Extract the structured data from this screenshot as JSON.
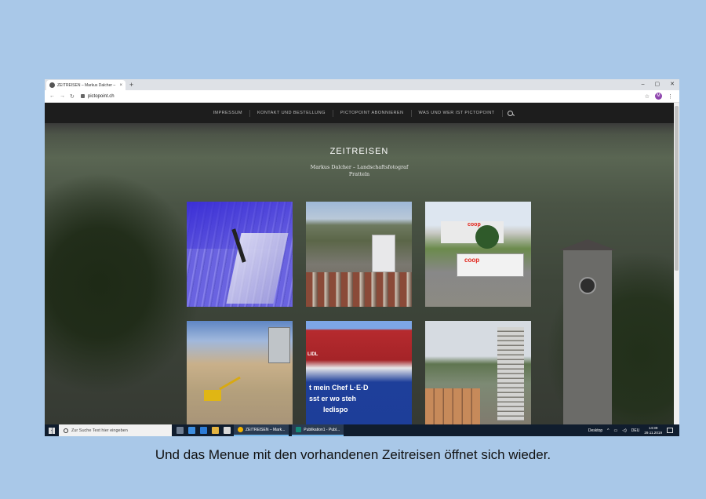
{
  "browser": {
    "tab_title": "ZEITREISEN – Markus Dalcher – L",
    "tab_close": "×",
    "new_tab": "+",
    "url": "pictopoint.ch",
    "window_controls": [
      "–",
      "▢",
      "✕"
    ],
    "profile_initial": "M"
  },
  "site": {
    "nav": [
      "IMPRESSUM",
      "KONTAKT UND BESTELLUNG",
      "PICTOPOINT ABONNIEREN",
      "WAS UND WER IST PICTOPOINT"
    ],
    "title": "ZEITREISEN",
    "desc_line1": "Markus Dalcher – Landschaftsfotograf",
    "desc_line2": "Pratteln",
    "thumb3_brand": "coop",
    "thumb3_truck_brand": "coop",
    "thumb5_brand": "LIDL",
    "thumb5_line1": "t mein Chef L·E·D",
    "thumb5_line2": "sst er wo steh",
    "thumb5_line3": "ledispo"
  },
  "taskbar": {
    "search_placeholder": "Zur Suche Text hier eingeben",
    "app1": "ZEITREISEN – Mark...",
    "app2": "Publikation1 - Publ...",
    "desktop_label": "Desktop",
    "lang": "DEU",
    "time": "14:39",
    "date": "29.11.2019"
  },
  "caption": "Und das Menue mit den vorhandenen Zeitreisen öffnet sich wieder.",
  "colors": {
    "background": "#a9c8e8",
    "nav_bar": "#1d1d1d",
    "taskbar": "#101d2e",
    "coop_red": "#e2231a"
  }
}
